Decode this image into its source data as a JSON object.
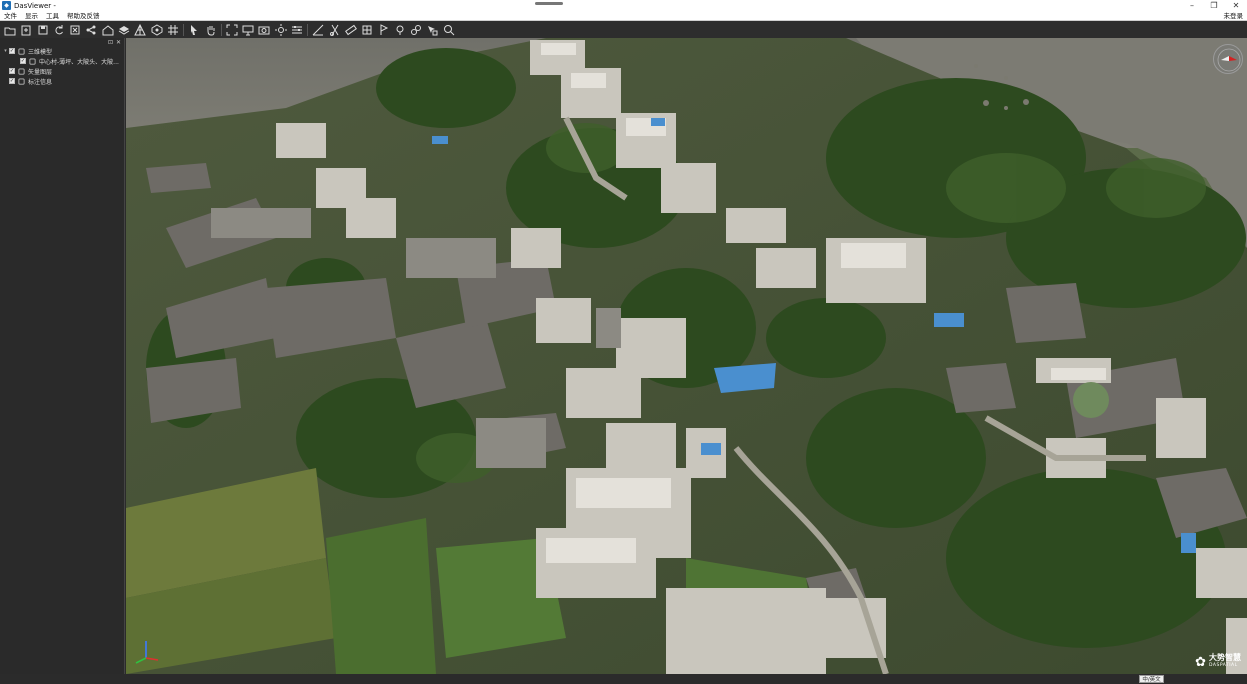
{
  "window": {
    "title": "DasViewer -",
    "login_label": "未登录"
  },
  "menu": {
    "items": [
      "文件",
      "显示",
      "工具",
      "帮助及反馈"
    ]
  },
  "toolbar": {
    "buttons": [
      {
        "name": "open-folder-icon"
      },
      {
        "name": "open-file-icon"
      },
      {
        "name": "save-icon"
      },
      {
        "name": "refresh-icon"
      },
      {
        "name": "close-scene-icon"
      },
      {
        "name": "share-icon"
      },
      {
        "name": "home-icon"
      },
      {
        "name": "layers-icon"
      },
      {
        "name": "triangle-mesh-icon"
      },
      {
        "name": "model-icon"
      },
      {
        "name": "grid-icon"
      },
      {
        "name": "cursor-select-icon"
      },
      {
        "name": "pan-hand-icon"
      },
      {
        "name": "fullscreen-icon"
      },
      {
        "name": "monitor-icon"
      },
      {
        "name": "screenshot-icon"
      },
      {
        "name": "lighting-icon"
      },
      {
        "name": "sliders-icon"
      },
      {
        "name": "measure-icon"
      },
      {
        "name": "clip-icon"
      },
      {
        "name": "ruler-icon"
      },
      {
        "name": "volume-icon"
      },
      {
        "name": "flag-icon"
      },
      {
        "name": "pin-icon"
      },
      {
        "name": "flight-icon"
      },
      {
        "name": "pointer-query-icon"
      },
      {
        "name": "zoom-query-icon"
      }
    ]
  },
  "panel": {
    "float_label": "⊡",
    "close_label": "✕",
    "tree": [
      {
        "label": "三维模型",
        "level": 0,
        "checked": true,
        "icon": "model-icon"
      },
      {
        "label": "中心村-薄坪、大陂头、大陂...",
        "level": 1,
        "checked": true,
        "icon": "model-file-icon"
      },
      {
        "label": "矢量图层",
        "level": 0,
        "checked": true,
        "icon": "vector-layer-icon"
      },
      {
        "label": "标注信息",
        "level": 0,
        "checked": true,
        "icon": "annotation-icon"
      }
    ]
  },
  "viewport": {
    "scene": "aerial-3d-village-model"
  },
  "logo": {
    "cn": "大势智慧",
    "en": "DASPATIAL"
  },
  "status": {
    "lang_label": "中/英文"
  },
  "colors": {
    "toolbar_bg": "#2d2d2d",
    "panel_bg": "#2a2a2a",
    "river": "#7a7a72",
    "canopy": "#2f4a22"
  }
}
